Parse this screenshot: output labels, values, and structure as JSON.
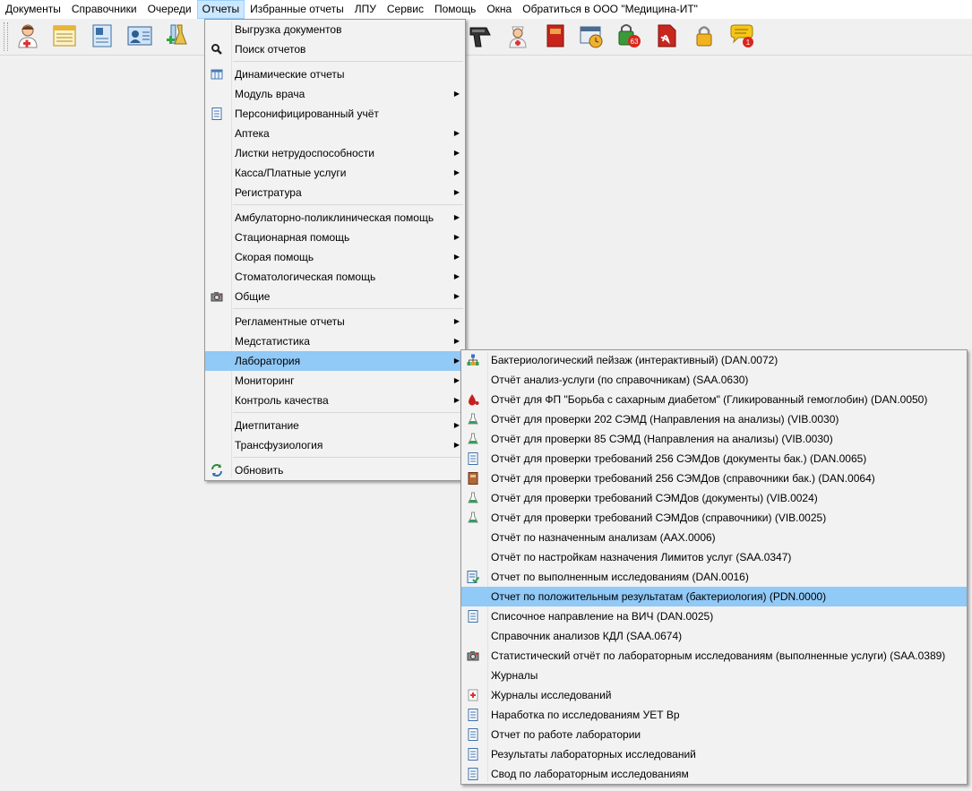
{
  "menubar": {
    "items": [
      {
        "label": "Документы"
      },
      {
        "label": "Справочники"
      },
      {
        "label": "Очереди"
      },
      {
        "label": "Отчеты"
      },
      {
        "label": "Избранные отчеты"
      },
      {
        "label": "ЛПУ"
      },
      {
        "label": "Сервис"
      },
      {
        "label": "Помощь"
      },
      {
        "label": "Окна"
      },
      {
        "label": "Обратиться в ООО \"Медицина-ИТ\""
      }
    ],
    "active_label": "Отчеты"
  },
  "toolbar": {
    "badges": {
      "lock_count": "63",
      "notify_count": "1"
    }
  },
  "reports_menu": {
    "items": [
      {
        "label": "Выгрузка документов"
      },
      {
        "label": "Поиск отчетов"
      },
      {
        "label": "Динамические отчеты"
      },
      {
        "label": "Модуль врача"
      },
      {
        "label": "Персонифицированный учёт"
      },
      {
        "label": "Аптека"
      },
      {
        "label": "Листки нетрудоспособности"
      },
      {
        "label": "Касса/Платные услуги"
      },
      {
        "label": "Регистратура"
      },
      {
        "label": "Амбулаторно-поликлиническая помощь"
      },
      {
        "label": "Стационарная помощь"
      },
      {
        "label": "Скорая помощь"
      },
      {
        "label": "Стоматологическая помощь"
      },
      {
        "label": "Общие"
      },
      {
        "label": "Регламентные отчеты"
      },
      {
        "label": "Медстатистика"
      },
      {
        "label": "Лаборатория"
      },
      {
        "label": "Мониторинг"
      },
      {
        "label": "Контроль качества"
      },
      {
        "label": "Диетпитание"
      },
      {
        "label": "Трансфузиология"
      },
      {
        "label": "Обновить"
      }
    ],
    "submenu_arrow": "▶"
  },
  "lab_submenu": {
    "items": [
      {
        "label": "Бактериологический пейзаж (интерактивный) (DAN.0072)"
      },
      {
        "label": "Отчёт анализ-услуги (по справочникам) (SAA.0630)"
      },
      {
        "label": "Отчёт для ФП \"Борьба с сахарным диабетом\" (Гликированный гемоглобин) (DAN.0050)"
      },
      {
        "label": "Отчёт для проверки 202 СЭМД (Направления на анализы) (VIB.0030)"
      },
      {
        "label": "Отчёт для проверки 85 СЭМД (Направления на анализы) (VIB.0030)"
      },
      {
        "label": "Отчёт для проверки требований 256 СЭМДов (документы бак.) (DAN.0065)"
      },
      {
        "label": "Отчёт для проверки требований 256 СЭМДов (справочники бак.) (DAN.0064)"
      },
      {
        "label": "Отчёт для проверки требований СЭМДов (документы) (VIB.0024)"
      },
      {
        "label": "Отчёт для проверки требований СЭМДов (справочники) (VIB.0025)"
      },
      {
        "label": "Отчёт по назначенным анализам (AAX.0006)"
      },
      {
        "label": "Отчёт по настройкам назначения Лимитов услуг (SAA.0347)"
      },
      {
        "label": "Отчет по выполненным исследованиям (DAN.0016)"
      },
      {
        "label": "Отчет по положительным результатам (бактериология) (PDN.0000)"
      },
      {
        "label": "Списочное направление на ВИЧ (DAN.0025)"
      },
      {
        "label": "Справочник анализов КДЛ (SAA.0674)"
      },
      {
        "label": "Статистический отчёт по лабораторным исследованиям (выполненные услуги) (SAA.0389)"
      },
      {
        "label": "Журналы"
      },
      {
        "label": "Журналы исследований"
      },
      {
        "label": "Наработка по исследованиям УЕТ Вр"
      },
      {
        "label": "Отчет по работе лаборатории"
      },
      {
        "label": "Результаты лабораторных исследований"
      },
      {
        "label": "Свод по лабораторным исследованиям"
      }
    ]
  }
}
